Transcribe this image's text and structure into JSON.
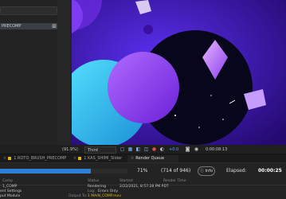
{
  "project": {
    "selected_item": "PRECOMP",
    "other_items": [
      "Solid Settings"
    ]
  },
  "viewer": {
    "zoom": "(91.9%)",
    "resolution": "Third",
    "exposure": "+0.0",
    "timecode": "0:00:08:13",
    "scene": {
      "background_color": "#2a0f7a",
      "accent_colors": [
        "#7b2ff7",
        "#3ad0ff",
        "#1d0960"
      ]
    }
  },
  "tabs": [
    {
      "label": "1 ROTO_BRUSH_PRECOMP"
    },
    {
      "label": "1 KAS_SHIMI_Slider"
    },
    {
      "label": "Render Queue"
    }
  ],
  "render": {
    "progress_fraction": 0.71,
    "percent_label": "71%",
    "frames_label": "(714 of 946)",
    "info_label": "Info",
    "elapsed_label": "Elapsed:",
    "elapsed_value": "00:00:25"
  },
  "queue": {
    "headers": [
      "Comp",
      "Status",
      "Started",
      "Render Time"
    ],
    "row": {
      "comp": "1_COMP",
      "status": "Rendering",
      "started": "2/22/2021, 8:57:28 PM PDT"
    },
    "row2": {
      "left": "ent Settings",
      "log_label": "Log:",
      "log_value": "Errors Only"
    },
    "row3": {
      "left": "put Module",
      "output_label": "Output To:",
      "output_value": "1 MAIN_COMP.mov"
    }
  }
}
